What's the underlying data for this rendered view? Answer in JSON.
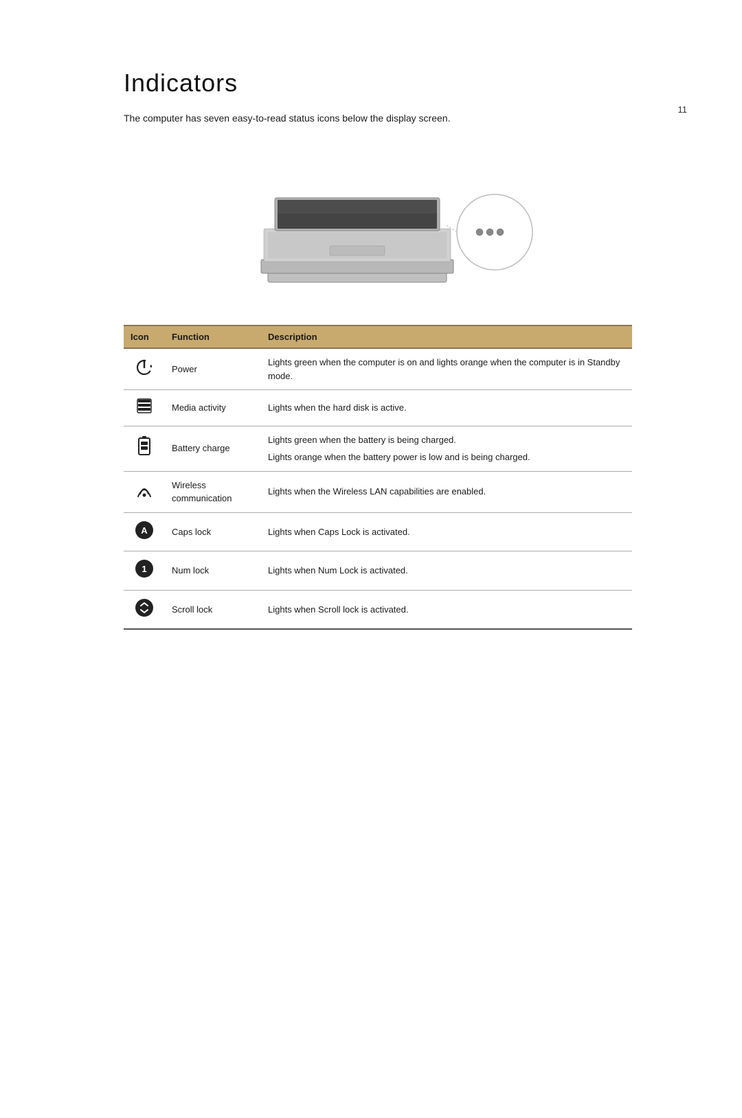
{
  "page": {
    "number": "11",
    "title": "Indicators",
    "intro": "The computer has seven easy-to-read status icons below the display screen."
  },
  "table": {
    "headers": {
      "icon": "Icon",
      "function": "Function",
      "description": "Description"
    },
    "rows": [
      {
        "icon": "⏻",
        "icon_name": "power-icon",
        "function": "Power",
        "description_lines": [
          "Lights green when the computer is on and lights orange when the computer is in Standby mode."
        ]
      },
      {
        "icon": "🖴",
        "icon_name": "media-activity-icon",
        "function": "Media activity",
        "description_lines": [
          "Lights when the hard disk is active."
        ]
      },
      {
        "icon": "🔋",
        "icon_name": "battery-charge-icon",
        "function": "Battery charge",
        "description_lines": [
          "Lights green when the battery is being charged.",
          "Lights orange when the battery power is low and is being charged."
        ]
      },
      {
        "icon": "☾",
        "icon_name": "wireless-communication-icon",
        "function": "Wireless communication",
        "description_lines": [
          "Lights when the Wireless LAN capabilities are enabled."
        ]
      },
      {
        "icon": "🅐",
        "icon_name": "caps-lock-icon",
        "function": "Caps lock",
        "description_lines": [
          "Lights when Caps Lock is activated."
        ]
      },
      {
        "icon": "🔢",
        "icon_name": "num-lock-icon",
        "function": "Num lock",
        "description_lines": [
          "Lights when Num Lock is activated."
        ]
      },
      {
        "icon": "↕",
        "icon_name": "scroll-lock-icon",
        "function": "Scroll lock",
        "description_lines": [
          "Lights when Scroll lock is activated."
        ]
      }
    ]
  }
}
